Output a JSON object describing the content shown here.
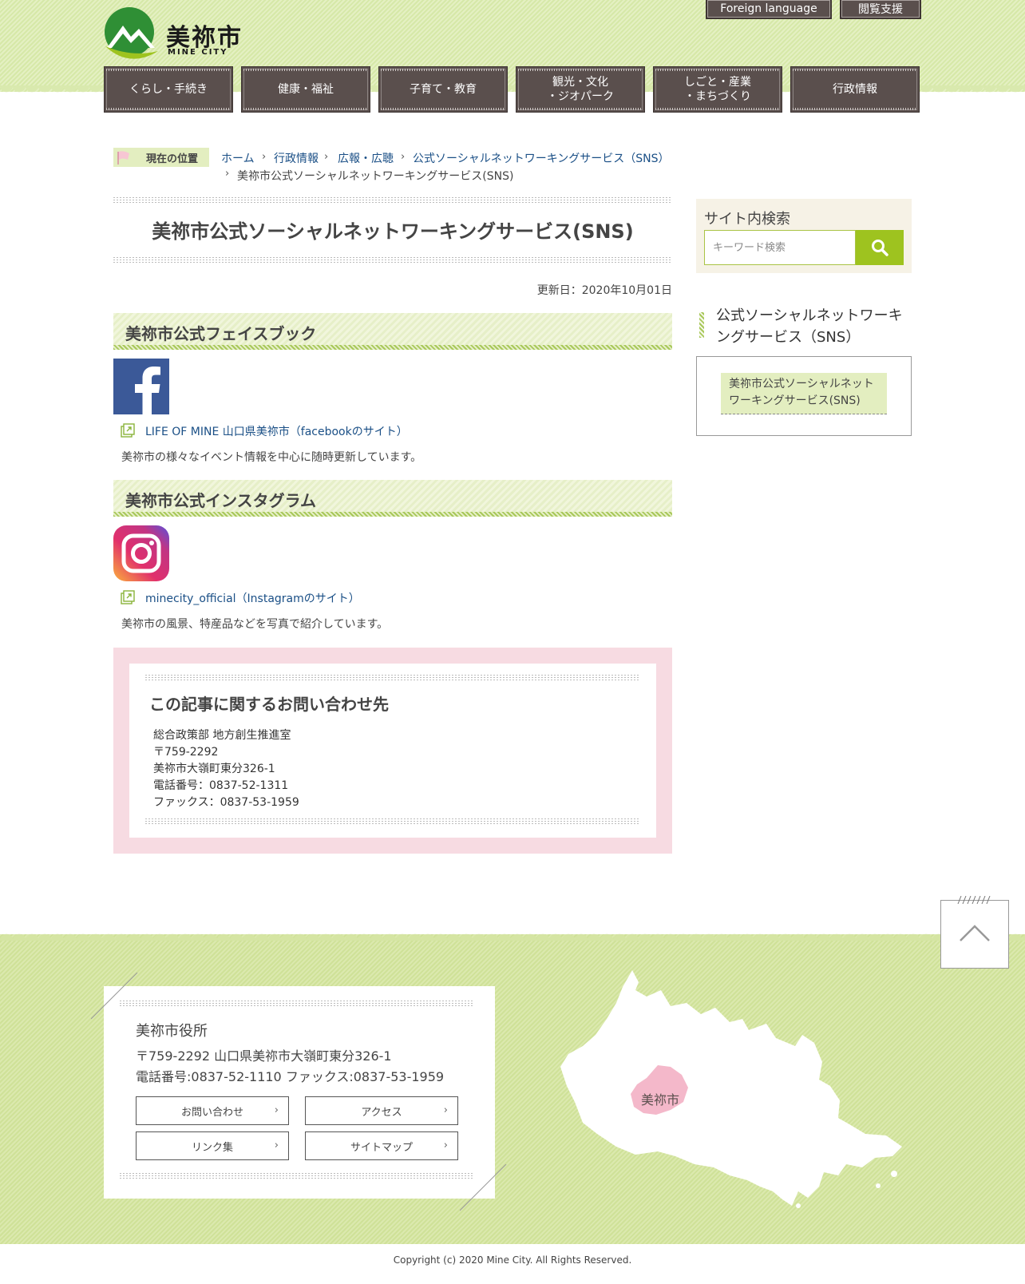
{
  "header": {
    "logo_text": "美祢市",
    "logo_sub": "MINE CITY",
    "foreign_language": "Foreign language",
    "reading_support": "閲覧支援"
  },
  "nav": [
    {
      "label": "くらし・手続き"
    },
    {
      "label": "健康・福祉"
    },
    {
      "label": "子育て・教育"
    },
    {
      "label": "観光・文化\n・ジオパーク"
    },
    {
      "label": "しごと・産業\n・まちづくり"
    },
    {
      "label": "行政情報"
    }
  ],
  "breadcrumb": {
    "label": "現在の位置",
    "items": [
      "ホーム",
      "行政情報",
      "広報・広聴",
      "公式ソーシャルネットワーキングサービス（SNS）"
    ],
    "current": "美祢市公式ソーシャルネットワーキングサービス(SNS)"
  },
  "main": {
    "title": "美祢市公式ソーシャルネットワーキングサービス(SNS)",
    "updated": "更新日：2020年10月01日",
    "facebook": {
      "heading": "美祢市公式フェイスブック",
      "link": "LIFE OF MINE 山口県美祢市（facebookのサイト）",
      "desc": "美祢市の様々なイベント情報を中心に随時更新しています。"
    },
    "instagram": {
      "heading": "美祢市公式インスタグラム",
      "link": "minecity_official（Instagramのサイト）",
      "desc": "美祢市の風景、特産品などを写真で紹介しています。"
    },
    "contact": {
      "title": "この記事に関するお問い合わせ先",
      "lines": [
        "総合政策部 地方創生推進室",
        "〒759-2292",
        "美祢市大嶺町東分326-1",
        "電話番号：0837-52-1311",
        "ファックス：0837-53-1959"
      ]
    }
  },
  "sidebar": {
    "search_title": "サイト内検索",
    "search_placeholder": "キーワード検索",
    "section_heading": "公式ソーシャルネットワーキングサービス（SNS）",
    "items": [
      "美祢市公式ソーシャルネットワーキングサービス(SNS)"
    ]
  },
  "footer": {
    "name": "美祢市役所",
    "address": "〒759-2292 山口県美祢市大嶺町東分326-1",
    "phone": "電話番号:0837-52-1110 ファックス:0837-53-1959",
    "buttons": [
      "お問い合わせ",
      "アクセス",
      "リンク集",
      "サイトマップ"
    ],
    "map_label": "美祢市",
    "copyright": "Copyright (c) 2020 Mine City. All Rights Reserved."
  },
  "colors": {
    "nav_bg": "#5a4f4d",
    "accent_green": "#9ec31f",
    "header_green": "#dbe9ae",
    "contact_pink": "#f7dbe2",
    "map_highlight": "#f4b8ca"
  }
}
